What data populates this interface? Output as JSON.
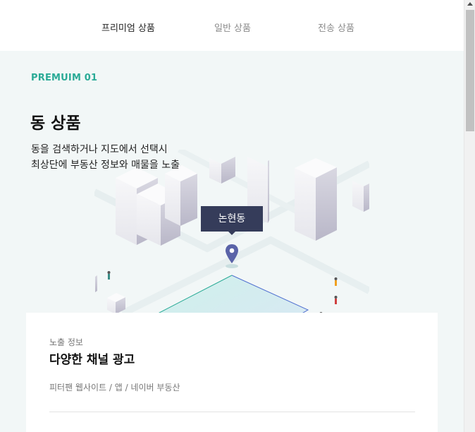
{
  "tabs": [
    {
      "label": "프리미엄 상품",
      "active": true
    },
    {
      "label": "일반 상품",
      "active": false
    },
    {
      "label": "전송 상품",
      "active": false
    }
  ],
  "hero": {
    "eyebrow": "PREMUIM 01",
    "title": "동 상품",
    "description_lines": [
      "동을 검색하거나 지도에서 선택시",
      "최상단에 부동산 정보와 매물을 노출"
    ],
    "map_label": "논현동",
    "accent_color": "#2bab97",
    "pin_color": "#5a63a8"
  },
  "card": {
    "eyebrow": "노출 정보",
    "title": "다양한 채널 광고",
    "subtitle": "피터팬 웹사이트 / 앱 / 네이버 부동산"
  },
  "icons": {
    "map_pin": "location-pin-icon",
    "scroll_up": "arrow-up-icon"
  }
}
